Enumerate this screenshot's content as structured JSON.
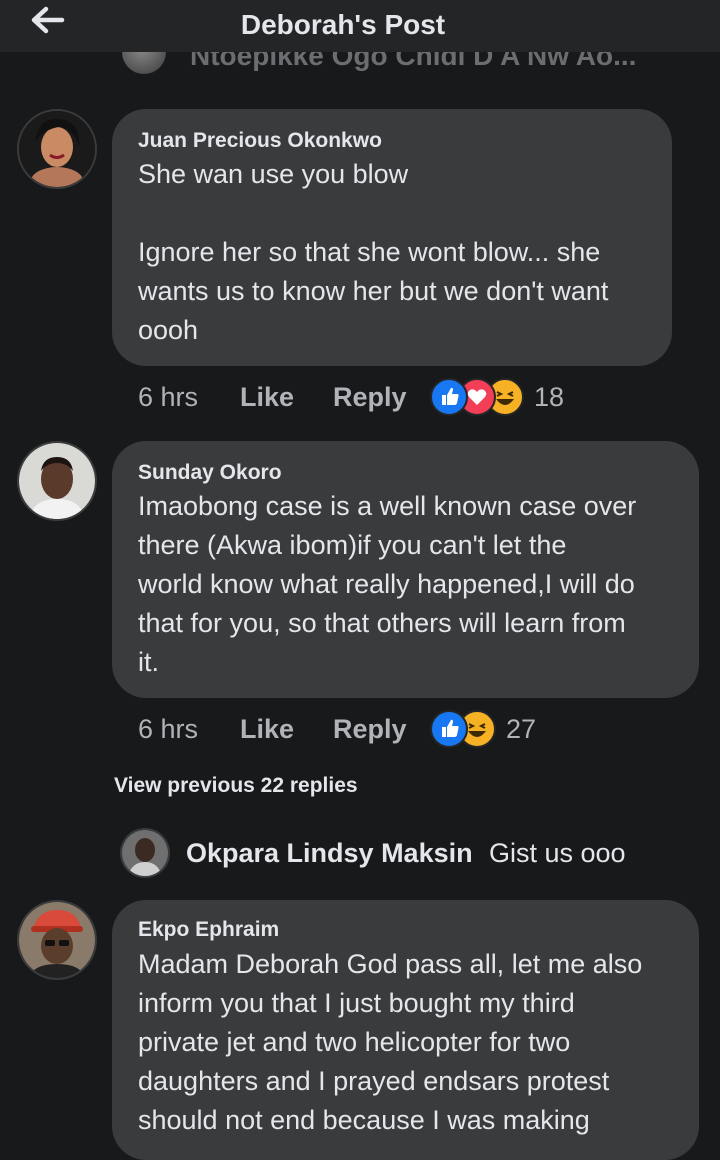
{
  "header": {
    "title": "Deborah's Post",
    "back_icon": "arrow-left-icon"
  },
  "partial_comment": {
    "text": "Ntoepikke Ogo  Chidi D A Nw Ao..."
  },
  "comments": [
    {
      "name": "Juan Precious Okonkwo",
      "lines": [
        "She wan use you blow",
        "",
        "Ignore her so that she wont blow... she",
        "wants us to know her but we don't want",
        "oooh"
      ],
      "time": "6 hrs",
      "like": "Like",
      "reply": "Reply",
      "reactions": [
        "like",
        "love",
        "haha"
      ],
      "reaction_count": "18"
    },
    {
      "name": "Sunday Okoro",
      "lines": [
        "Imaobong case is a well known case over",
        "there (Akwa ibom)if you can't let the",
        "world know what really happened,I will do",
        "that for you, so that others will learn from",
        "it."
      ],
      "time": "6 hrs",
      "like": "Like",
      "reply": "Reply",
      "reactions": [
        "like",
        "haha"
      ],
      "reaction_count": "27"
    }
  ],
  "view_previous": "View previous 22 replies",
  "latest_reply": {
    "name": "Okpara Lindsy Maksin",
    "text": "Gist us ooo"
  },
  "comment3": {
    "name": "Ekpo Ephraim",
    "lines": [
      "Madam Deborah God pass all, let me also",
      "inform you that I just bought my third",
      "private jet and two helicopter for two",
      "daughters and I prayed endsars protest",
      "should not end because I was making"
    ]
  },
  "colors": {
    "background": "#18191a",
    "topbar": "#242526",
    "bubble": "#3a3b3c",
    "text": "#e4e6eb",
    "meta": "#b0b3b8",
    "like_blue": "#1877f2",
    "love_red": "#f33e58",
    "haha_yellow": "#f7b125"
  }
}
